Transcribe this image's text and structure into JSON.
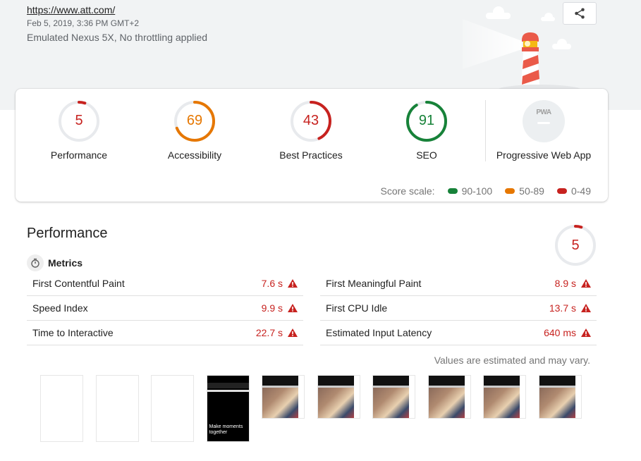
{
  "header": {
    "url": "https://www.att.com/",
    "date": "Feb 5, 2019, 3:36 PM GMT+2",
    "device": "Emulated Nexus 5X, No throttling applied",
    "share_icon": "share-icon"
  },
  "colors": {
    "pass": "#178239",
    "average": "#e67700",
    "fail": "#c7221f",
    "gauge_track": "#e8eaed"
  },
  "categories": [
    {
      "label": "Performance",
      "score": 5,
      "status": "fail"
    },
    {
      "label": "Accessibility",
      "score": 69,
      "status": "average"
    },
    {
      "label": "Best Practices",
      "score": 43,
      "status": "fail"
    },
    {
      "label": "SEO",
      "score": 91,
      "status": "pass"
    }
  ],
  "pwa": {
    "label": "Progressive Web App",
    "badge_text": "PWA"
  },
  "score_scale": {
    "label": "Score scale:",
    "items": [
      {
        "range": "90-100",
        "status": "pass"
      },
      {
        "range": "50-89",
        "status": "average"
      },
      {
        "range": "0-49",
        "status": "fail"
      }
    ]
  },
  "performance": {
    "title": "Performance",
    "score": 5,
    "metrics_label": "Metrics",
    "metrics_left": [
      {
        "name": "First Contentful Paint",
        "value": "7.6 s"
      },
      {
        "name": "Speed Index",
        "value": "9.9 s"
      },
      {
        "name": "Time to Interactive",
        "value": "22.7 s"
      }
    ],
    "metrics_right": [
      {
        "name": "First Meaningful Paint",
        "value": "8.9 s"
      },
      {
        "name": "First CPU Idle",
        "value": "13.7 s"
      },
      {
        "name": "Estimated Input Latency",
        "value": "640 ms"
      }
    ],
    "note": "Values are estimated and may vary.",
    "filmstrip": [
      {
        "kind": "blank"
      },
      {
        "kind": "blank"
      },
      {
        "kind": "blank"
      },
      {
        "kind": "dark",
        "caption": "Make moments together"
      },
      {
        "kind": "photo"
      },
      {
        "kind": "photo"
      },
      {
        "kind": "photo"
      },
      {
        "kind": "photo"
      },
      {
        "kind": "photo"
      },
      {
        "kind": "photo"
      }
    ]
  }
}
